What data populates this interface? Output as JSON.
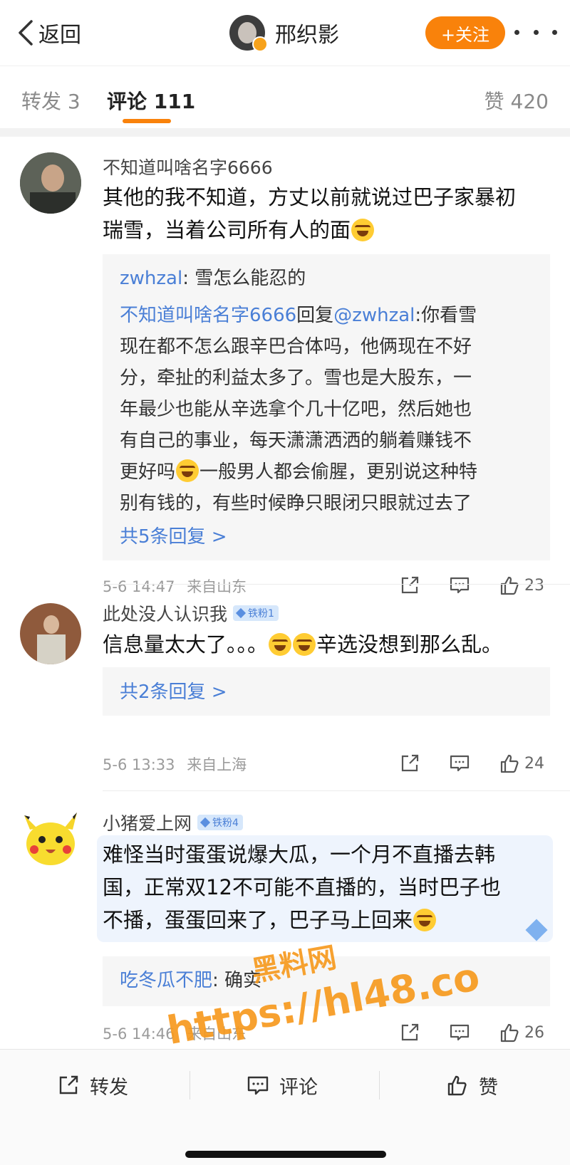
{
  "header": {
    "back_label": "返回",
    "username": "邢织影",
    "follow_label": "+关注"
  },
  "tabs": {
    "repost": "转发 3",
    "comment": "评论 111",
    "like": "赞 420"
  },
  "comments": [
    {
      "name": "不知道叫啥名字6666",
      "text_line1": "其他的我不知道，方丈以前就说过巴子家暴初",
      "text_line2": "瑞雪，当着公司所有人的面",
      "reply1_user": "zwhzal",
      "reply1_text": ": 雪怎么能忍的",
      "reply2_user": "不知道叫啥名字6666",
      "reply2_mid": "回复",
      "reply2_at": "@zwhzal",
      "reply2_text1": ":你看雪",
      "reply2_line2": "现在都不怎么跟辛巴合体吗，他俩现在不好",
      "reply2_line3": "分，牵扯的利益太多了。雪也是大股东，一",
      "reply2_line4": "年最少也能从辛选拿个几十亿吧，然后她也",
      "reply2_line5": "有自己的事业，每天潇潇洒洒的躺着赚钱不",
      "reply2_line6a": "更好吗",
      "reply2_line6b": "一般男人都会偷腥，更别说这种特",
      "reply2_line7": "别有钱的，有些时候睁只眼闭只眼就过去了",
      "more_replies": "共5条回复 >",
      "time": "5-6 14:47",
      "location": "来自山东",
      "likes": "23"
    },
    {
      "name": "此处没人认识我",
      "badge": "铁粉1",
      "text_a": "信息量太大了。。。",
      "text_b": "辛选没想到那么乱。",
      "more_replies": "共2条回复 >",
      "time": "5-6 13:33",
      "location": "来自上海",
      "likes": "24"
    },
    {
      "name": "小猪爱上网",
      "badge": "铁粉4",
      "text_line1": "难怪当时蛋蛋说爆大瓜，一个月不直播去韩",
      "text_line2": "国，正常双12不可能不直播的，当时巴子也",
      "text_line3": "不播，蛋蛋回来了，巴子马上回来",
      "reply_user": "吃冬瓜不肥",
      "reply_text": ": 确实",
      "time": "5-6 14:46",
      "location": "来自山东",
      "likes": "26"
    }
  ],
  "bottom_bar": {
    "repost": "转发",
    "comment": "评论",
    "like": "赞"
  },
  "watermark": {
    "line1": "黑料网",
    "line2": "https://hl48.co"
  }
}
